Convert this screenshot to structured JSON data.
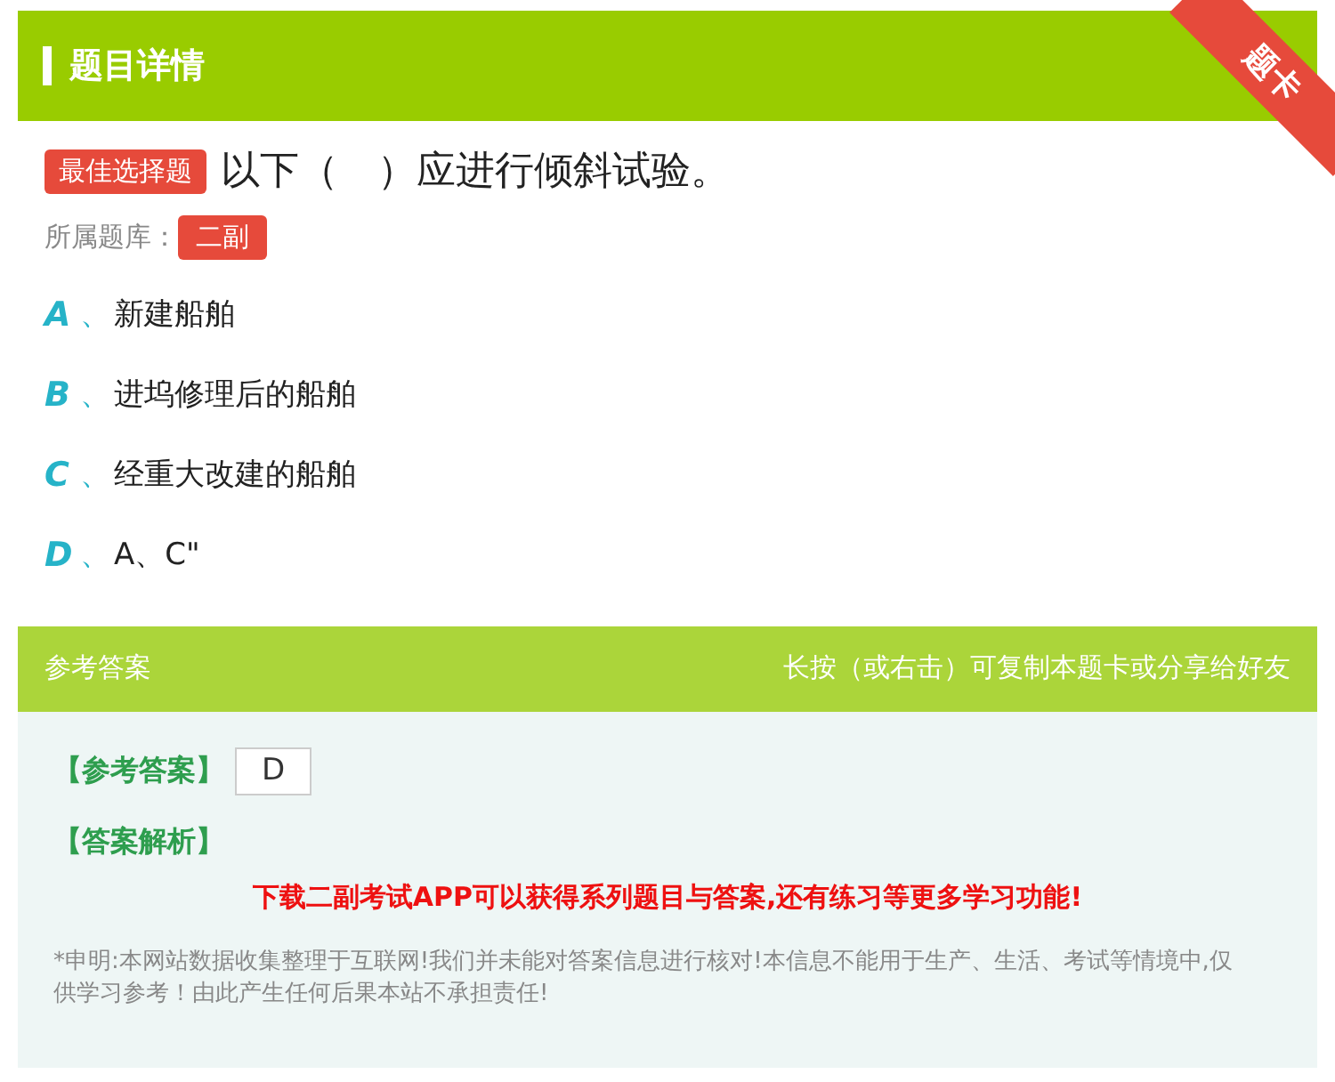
{
  "header": {
    "title": "题目详情",
    "ribbon": "题卡"
  },
  "question": {
    "type_badge": "最佳选择题",
    "text": "以下（　）应进行倾斜试验。",
    "bank_label": "所属题库：",
    "bank_badge": "二副"
  },
  "options": [
    {
      "letter": "A",
      "separator": "、",
      "text": "新建船舶"
    },
    {
      "letter": "B",
      "separator": "、",
      "text": "进坞修理后的船舶"
    },
    {
      "letter": "C",
      "separator": "、",
      "text": "经重大改建的船舶"
    },
    {
      "letter": "D",
      "separator": "、",
      "text": "A、C\""
    }
  ],
  "answer_section": {
    "title": "参考答案",
    "hint": "长按（或右击）可复制本题卡或分享给好友",
    "answer_label": "【参考答案】",
    "answer": "D",
    "analysis_label": "【答案解析】",
    "promo": "下载二副考试APP可以获得系列题目与答案,还有练习等更多学习功能!",
    "disclaimer": "*申明:本网站数据收集整理于互联网!我们并未能对答案信息进行核对!本信息不能用于生产、生活、考试等情境中,仅供学习参考！由此产生任何后果本站不承担责任!"
  }
}
